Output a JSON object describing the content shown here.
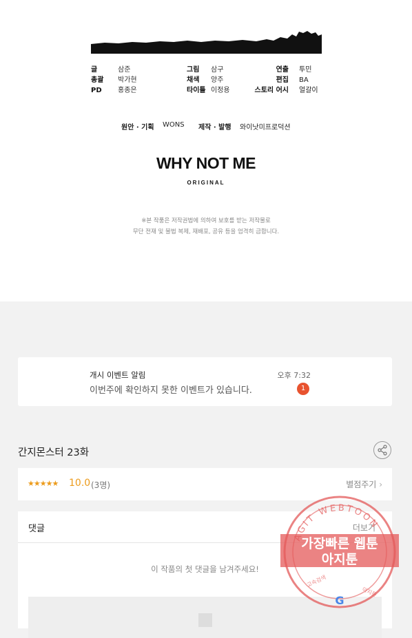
{
  "credits": {
    "col1": [
      {
        "role": "글",
        "name": "삼준"
      },
      {
        "role": "총괄",
        "name": "박가현"
      },
      {
        "role": "PD",
        "name": "홍종은"
      }
    ],
    "col2": [
      {
        "role": "그림",
        "name": "삼구"
      },
      {
        "role": "채색",
        "name": "양주"
      },
      {
        "role": "타이틀",
        "name": "이정용"
      }
    ],
    "col3": [
      {
        "role": "연출",
        "name": "투민"
      },
      {
        "role": "편집",
        "name": "BA"
      },
      {
        "role": "스토리 어시",
        "name": "얼갈이"
      }
    ]
  },
  "original": {
    "plan_label": "원안 · 기획",
    "plan_value": "WONS",
    "publish_label": "제작 · 발행",
    "publish_value": "와이낫미프로덕션"
  },
  "brand": {
    "name": "WHY NOT ME",
    "sub": "ORIGINAL"
  },
  "notice": {
    "line1": "※본 작품은 저작권법에 의하여 보호를 받는 저작물로",
    "line2": "무단 전재 및 불법 복제, 재배포, 공유 등을 엄격히 금합니다."
  },
  "alert": {
    "title": "개시 이벤트 알림",
    "message": "이번주에 확인하지 못한 이벤트가 있습니다.",
    "time": "오후 7:32",
    "badge": "1"
  },
  "episode": {
    "title": "간지몬스터 23화",
    "share_icon": "share-icon"
  },
  "rating": {
    "stars": "★★★★★",
    "score": "10.0",
    "count": "(3명)",
    "rate_label": "별점주기"
  },
  "comments": {
    "title": "댓글",
    "more_label": "더보기",
    "empty_text": "이 작품의 첫 댓글을 남겨주세요!"
  },
  "watermark": {
    "arc_text": "AGIT WEBTOON",
    "line1": "가장빠른 웹툰",
    "line2": "아지툰",
    "small_left": "고속검색",
    "small_right": "아지툰"
  },
  "colors": {
    "accent": "#ec9b1b",
    "badge": "#e8532f",
    "watermark": "#e45a5a"
  }
}
